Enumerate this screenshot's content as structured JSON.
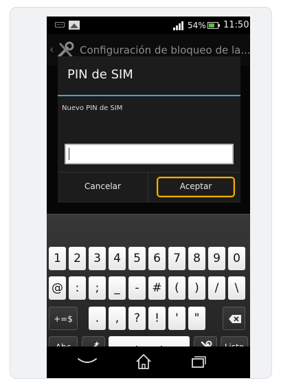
{
  "status_bar": {
    "battery_text": "54%",
    "time": "11:50"
  },
  "action_bar": {
    "title": "Configuración de bloqueo de la..."
  },
  "dialog": {
    "title": "PIN de SIM",
    "message": "Nuevo PIN de SIM",
    "pin_value": "",
    "cancel_label": "Cancelar",
    "accept_label": "Aceptar"
  },
  "keyboard": {
    "row1": [
      "1",
      "2",
      "3",
      "4",
      "5",
      "6",
      "7",
      "8",
      "9",
      "0"
    ],
    "row2": [
      "@",
      ":",
      ";",
      "_",
      "-",
      "#",
      "(",
      ")",
      "/",
      "\\"
    ],
    "row3_symbols": "+=$",
    "row3": [
      ".",
      ",",
      "?",
      "!",
      "'",
      "\""
    ],
    "abc_label": "Abc",
    "done_label": "Listo"
  },
  "colors": {
    "accent": "#3fa7d6",
    "focus_ring": "#f3b000",
    "battery": "#57c23a"
  },
  "icons": [
    "keyboard-notification-icon",
    "image-notification-icon",
    "signal-icon",
    "battery-icon",
    "tools-icon",
    "backspace-icon",
    "magic-wand-icon",
    "space-icon",
    "tools-key-icon",
    "back-nav-icon",
    "home-nav-icon",
    "recent-apps-icon"
  ]
}
